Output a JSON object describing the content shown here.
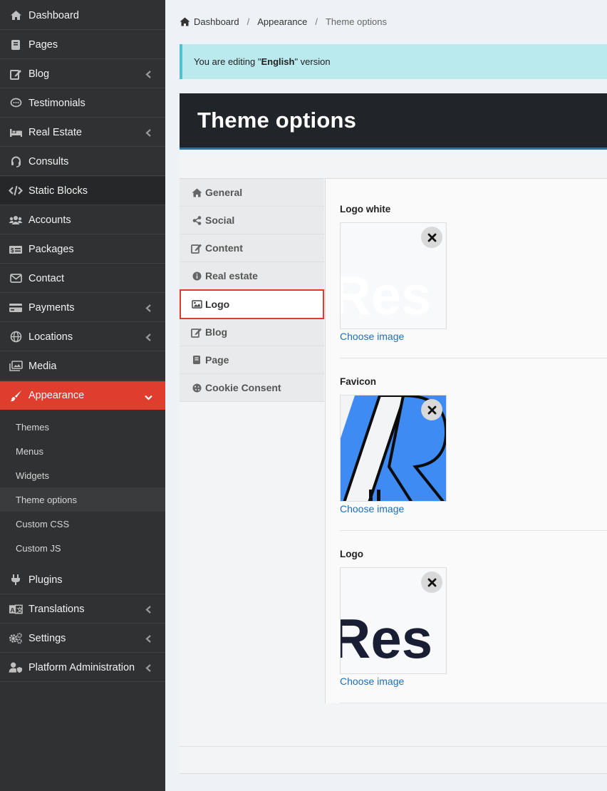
{
  "sidebar": {
    "items": [
      {
        "label": "Dashboard",
        "icon": "home-icon"
      },
      {
        "label": "Pages",
        "icon": "book-icon"
      },
      {
        "label": "Blog",
        "icon": "edit-icon",
        "arrow": true
      },
      {
        "label": "Testimonials",
        "icon": "comment-icon"
      },
      {
        "label": "Real Estate",
        "icon": "bed-icon",
        "arrow": true
      },
      {
        "label": "Consults",
        "icon": "headset-icon"
      },
      {
        "label": "Static Blocks",
        "icon": "code-icon"
      },
      {
        "label": "Accounts",
        "icon": "users-icon"
      },
      {
        "label": "Packages",
        "icon": "money-icon"
      },
      {
        "label": "Contact",
        "icon": "envelope-icon"
      },
      {
        "label": "Payments",
        "icon": "credit-card-icon",
        "arrow": true
      },
      {
        "label": "Locations",
        "icon": "globe-icon",
        "arrow": true
      },
      {
        "label": "Media",
        "icon": "images-icon"
      },
      {
        "label": "Appearance",
        "icon": "paintbrush-icon",
        "expanded": true
      },
      {
        "label": "Plugins",
        "icon": "plug-icon"
      },
      {
        "label": "Translations",
        "icon": "language-icon",
        "arrow": true
      },
      {
        "label": "Settings",
        "icon": "cogs-icon",
        "arrow": true
      },
      {
        "label": "Platform Administration",
        "icon": "user-shield-icon",
        "arrow": true
      }
    ],
    "subitems": [
      "Themes",
      "Menus",
      "Widgets",
      "Theme options",
      "Custom CSS",
      "Custom JS"
    ],
    "active_color": "#df3d2e"
  },
  "breadcrumb": {
    "items": [
      "Dashboard",
      "Appearance",
      "Theme options"
    ],
    "separator": "/"
  },
  "alert": {
    "prefix": "You are editing \"",
    "language": "English",
    "suffix": "\" version"
  },
  "panel": {
    "title": "Theme options"
  },
  "tabs": [
    {
      "label": "General",
      "icon": "home-icon"
    },
    {
      "label": "Social",
      "icon": "share-icon"
    },
    {
      "label": "Content",
      "icon": "edit-icon"
    },
    {
      "label": "Real estate",
      "icon": "info-icon"
    },
    {
      "label": "Logo",
      "icon": "image-icon",
      "active": true
    },
    {
      "label": "Blog",
      "icon": "edit-icon"
    },
    {
      "label": "Page",
      "icon": "book-icon"
    },
    {
      "label": "Cookie Consent",
      "icon": "cookie-icon"
    }
  ],
  "fields": [
    {
      "label": "Logo white",
      "action": "Choose image"
    },
    {
      "label": "Favicon",
      "action": "Choose image"
    },
    {
      "label": "Logo",
      "action": "Choose image"
    }
  ],
  "logo_text": "Res"
}
